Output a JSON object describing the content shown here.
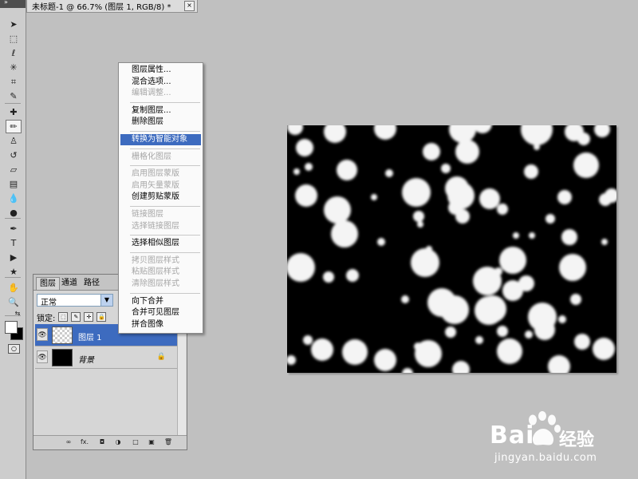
{
  "document": {
    "tab_title": "未标题-1 @ 66.7% (图层 1, RGB/8) *",
    "close_glyph": "×"
  },
  "toolbar": {
    "collapse_glyph": "»",
    "tools": [
      {
        "name": "move-tool-icon",
        "glyph": "➤",
        "active": false
      },
      {
        "name": "marquee-tool-icon",
        "glyph": "⬚",
        "active": false
      },
      {
        "name": "lasso-tool-icon",
        "glyph": "ℓ",
        "active": false
      },
      {
        "name": "magic-wand-tool-icon",
        "glyph": "✳",
        "active": false
      },
      {
        "name": "crop-tool-icon",
        "glyph": "⌗",
        "active": false
      },
      {
        "name": "eyedropper-tool-icon",
        "glyph": "✎",
        "active": false
      },
      {
        "name": "healing-brush-tool-icon",
        "glyph": "✚",
        "active": false
      },
      {
        "name": "brush-tool-icon",
        "glyph": "✏",
        "active": true
      },
      {
        "name": "clone-stamp-tool-icon",
        "glyph": "♙",
        "active": false
      },
      {
        "name": "history-brush-tool-icon",
        "glyph": "↺",
        "active": false
      },
      {
        "name": "eraser-tool-icon",
        "glyph": "▱",
        "active": false
      },
      {
        "name": "gradient-tool-icon",
        "glyph": "▤",
        "active": false
      },
      {
        "name": "blur-tool-icon",
        "glyph": "💧",
        "active": false
      },
      {
        "name": "dodge-tool-icon",
        "glyph": "●",
        "active": false
      },
      {
        "name": "pen-tool-icon",
        "glyph": "✒",
        "active": false
      },
      {
        "name": "type-tool-icon",
        "glyph": "T",
        "active": false
      },
      {
        "name": "path-selection-tool-icon",
        "glyph": "▶",
        "active": false
      },
      {
        "name": "shape-tool-icon",
        "glyph": "★",
        "active": false
      },
      {
        "name": "hand-tool-icon",
        "glyph": "✋",
        "active": false
      },
      {
        "name": "zoom-tool-icon",
        "glyph": "🔍",
        "active": false
      }
    ],
    "swap_glyph": "⇆",
    "quickmask_glyph": "○"
  },
  "layers_panel": {
    "tabs": [
      {
        "label": "图层",
        "active": true
      },
      {
        "label": "通道",
        "active": false
      },
      {
        "label": "路径",
        "active": false
      }
    ],
    "blend_mode": "正常",
    "dropdown_glyph": "▼",
    "lock_label": "锁定:",
    "lock_glyphs": [
      "⬚",
      "✎",
      "✛",
      "🔒"
    ],
    "layers": [
      {
        "name": "图层 1",
        "selected": true,
        "thumb": "transparent",
        "italic": false,
        "locked": false
      },
      {
        "name": "背景",
        "selected": false,
        "thumb": "black",
        "italic": true,
        "locked": true
      }
    ],
    "eye_glyph": "👁",
    "layer_lock_glyph": "🔒",
    "footer_glyphs": [
      "∞",
      "fx.",
      "◘",
      "◑",
      "□",
      "▣",
      "🗑"
    ]
  },
  "context_menu": {
    "items": [
      {
        "label": "图层属性...",
        "state": "normal"
      },
      {
        "label": "混合选项...",
        "state": "normal"
      },
      {
        "label": "编辑调整...",
        "state": "disabled"
      },
      {
        "sep": true
      },
      {
        "label": "复制图层...",
        "state": "normal"
      },
      {
        "label": "删除图层",
        "state": "normal"
      },
      {
        "sep": true
      },
      {
        "label": "转换为智能对象",
        "state": "highlighted"
      },
      {
        "sep": true
      },
      {
        "label": "栅格化图层",
        "state": "disabled"
      },
      {
        "sep": true
      },
      {
        "label": "启用图层蒙版",
        "state": "disabled"
      },
      {
        "label": "启用矢量蒙版",
        "state": "disabled"
      },
      {
        "label": "创建剪贴蒙版",
        "state": "normal"
      },
      {
        "sep": true
      },
      {
        "label": "链接图层",
        "state": "disabled"
      },
      {
        "label": "选择链接图层",
        "state": "disabled"
      },
      {
        "sep": true
      },
      {
        "label": "选择相似图层",
        "state": "normal"
      },
      {
        "sep": true
      },
      {
        "label": "拷贝图层样式",
        "state": "disabled"
      },
      {
        "label": "粘贴图层样式",
        "state": "disabled"
      },
      {
        "label": "清除图层样式",
        "state": "disabled"
      },
      {
        "sep": true
      },
      {
        "label": "向下合并",
        "state": "normal"
      },
      {
        "label": "合并可见图层",
        "state": "normal"
      },
      {
        "label": "拼合图像",
        "state": "normal"
      }
    ]
  },
  "watermark": {
    "brand": "Bai",
    "brand_cn": "经验",
    "url": "jingyan.baidu.com"
  },
  "colors": {
    "canvas_bg": "#000000",
    "highlight": "#3d6bbf",
    "workspace": "#c0c0c0",
    "bokeh": "#f4f4f4"
  }
}
